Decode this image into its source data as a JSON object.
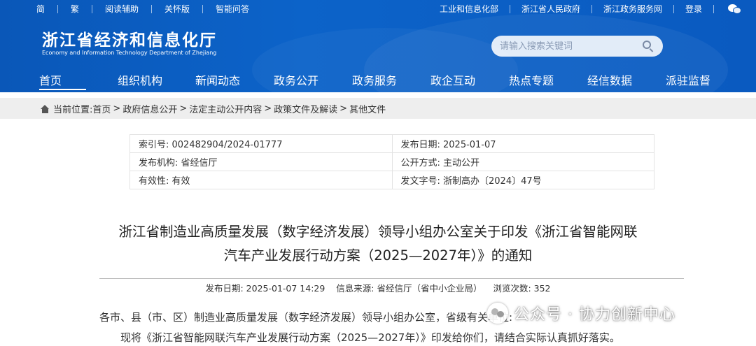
{
  "topbar": {
    "left_links": [
      "简",
      "繁",
      "阅读辅助",
      "关怀版",
      "智能问答"
    ],
    "right_links": [
      "工业和信息化部",
      "浙江省人民政府",
      "浙江政务服务网",
      "登录"
    ]
  },
  "logo": {
    "title": "浙江省经济和信息化厅",
    "subtitle": "Economy and Information Technology Department of Zhejiang"
  },
  "search": {
    "placeholder": "请输入搜索关键词"
  },
  "nav": {
    "items": [
      "首页",
      "组织机构",
      "新闻动态",
      "政务公开",
      "政务服务",
      "政企互动",
      "热点专题",
      "经信数据",
      "派驻监督"
    ],
    "active": "首页"
  },
  "breadcrumb": {
    "label": "当前位置:",
    "items": [
      "首页",
      "政府信息公开",
      "法定主动公开内容",
      "政策文件及解读",
      "其他文件"
    ]
  },
  "meta": {
    "index_no": "索引号: 002482904/2024-01777",
    "publish_date": "发布日期: 2025-01-07",
    "publisher": "发布机构: 省经信厅",
    "disclosure": "公开方式: 主动公开",
    "validity": "有效性: 有效",
    "doc_no": "发文字号: 浙制高办〔2024〕47号"
  },
  "article": {
    "title_line1": "浙江省制造业高质量发展（数字经济发展）领导小组办公室关于印发《浙江省智能网联",
    "title_line2": "汽车产业发展行动方案（2025—2027年）》的通知",
    "publish_time": "发布日期: 2025-01-07 14:29",
    "source": "信息来源: 省经信厅（省中小企业局）",
    "views": "浏览次数: 352",
    "para1": "各市、县（市、区）制造业高质量发展（数字经济发展）领导小组办公室，省级有关单位:",
    "para2": "现将《浙江省智能网联汽车产业发展行动方案（2025—2027年）》印发给你们，请结合实际认真抓好落实。"
  },
  "watermark": {
    "text": "公众号 · 协力创新中心"
  },
  "colors": {
    "header_blue": "#0a57b8",
    "breadcrumb_bg": "#eeeeee"
  }
}
